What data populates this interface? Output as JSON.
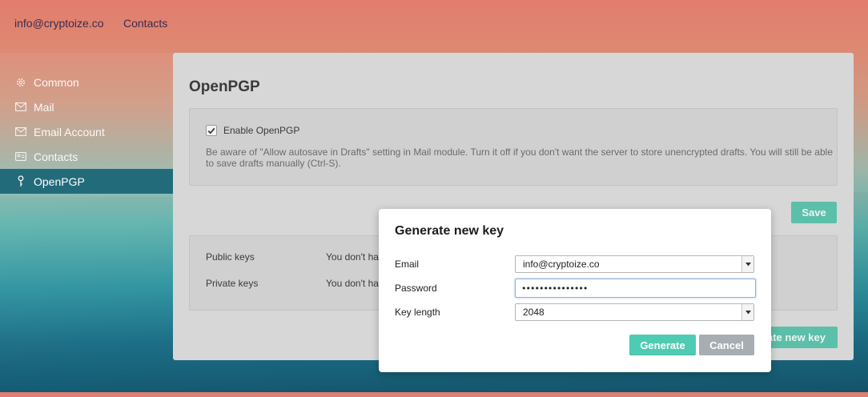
{
  "topbar": {
    "account": "info@cryptoize.co",
    "contacts": "Contacts"
  },
  "sidebar": {
    "items": [
      {
        "label": "Common",
        "icon": "gear-icon"
      },
      {
        "label": "Mail",
        "icon": "envelope-icon"
      },
      {
        "label": "Email Account",
        "icon": "envelope-icon"
      },
      {
        "label": "Contacts",
        "icon": "contact-card-icon"
      },
      {
        "label": "OpenPGP",
        "icon": "key-icon",
        "active": true
      }
    ]
  },
  "panel": {
    "title": "OpenPGP",
    "enable_label": "Enable OpenPGP",
    "enable_checked": true,
    "hint": "Be aware of \"Allow autosave in Drafts\" setting in Mail module. Turn it off if you don't want the server to store unencrypted drafts. You will still be able to save drafts manually (Ctrl-S).",
    "save_label": "Save",
    "public_keys_label": "Public keys",
    "public_keys_value": "You don't ha",
    "private_keys_label": "Private keys",
    "private_keys_value": "You don't ha",
    "generate_new_key_label": "ate new key"
  },
  "modal": {
    "title": "Generate new key",
    "email_label": "Email",
    "email_value": "info@cryptoize.co",
    "password_label": "Password",
    "password_value": "•••••••••••••••",
    "key_length_label": "Key length",
    "key_length_value": "2048",
    "generate_label": "Generate",
    "cancel_label": "Cancel"
  },
  "colors": {
    "accent": "#4fcbb3",
    "cancel": "#a7adb2",
    "sidebar_active": "#186476"
  }
}
